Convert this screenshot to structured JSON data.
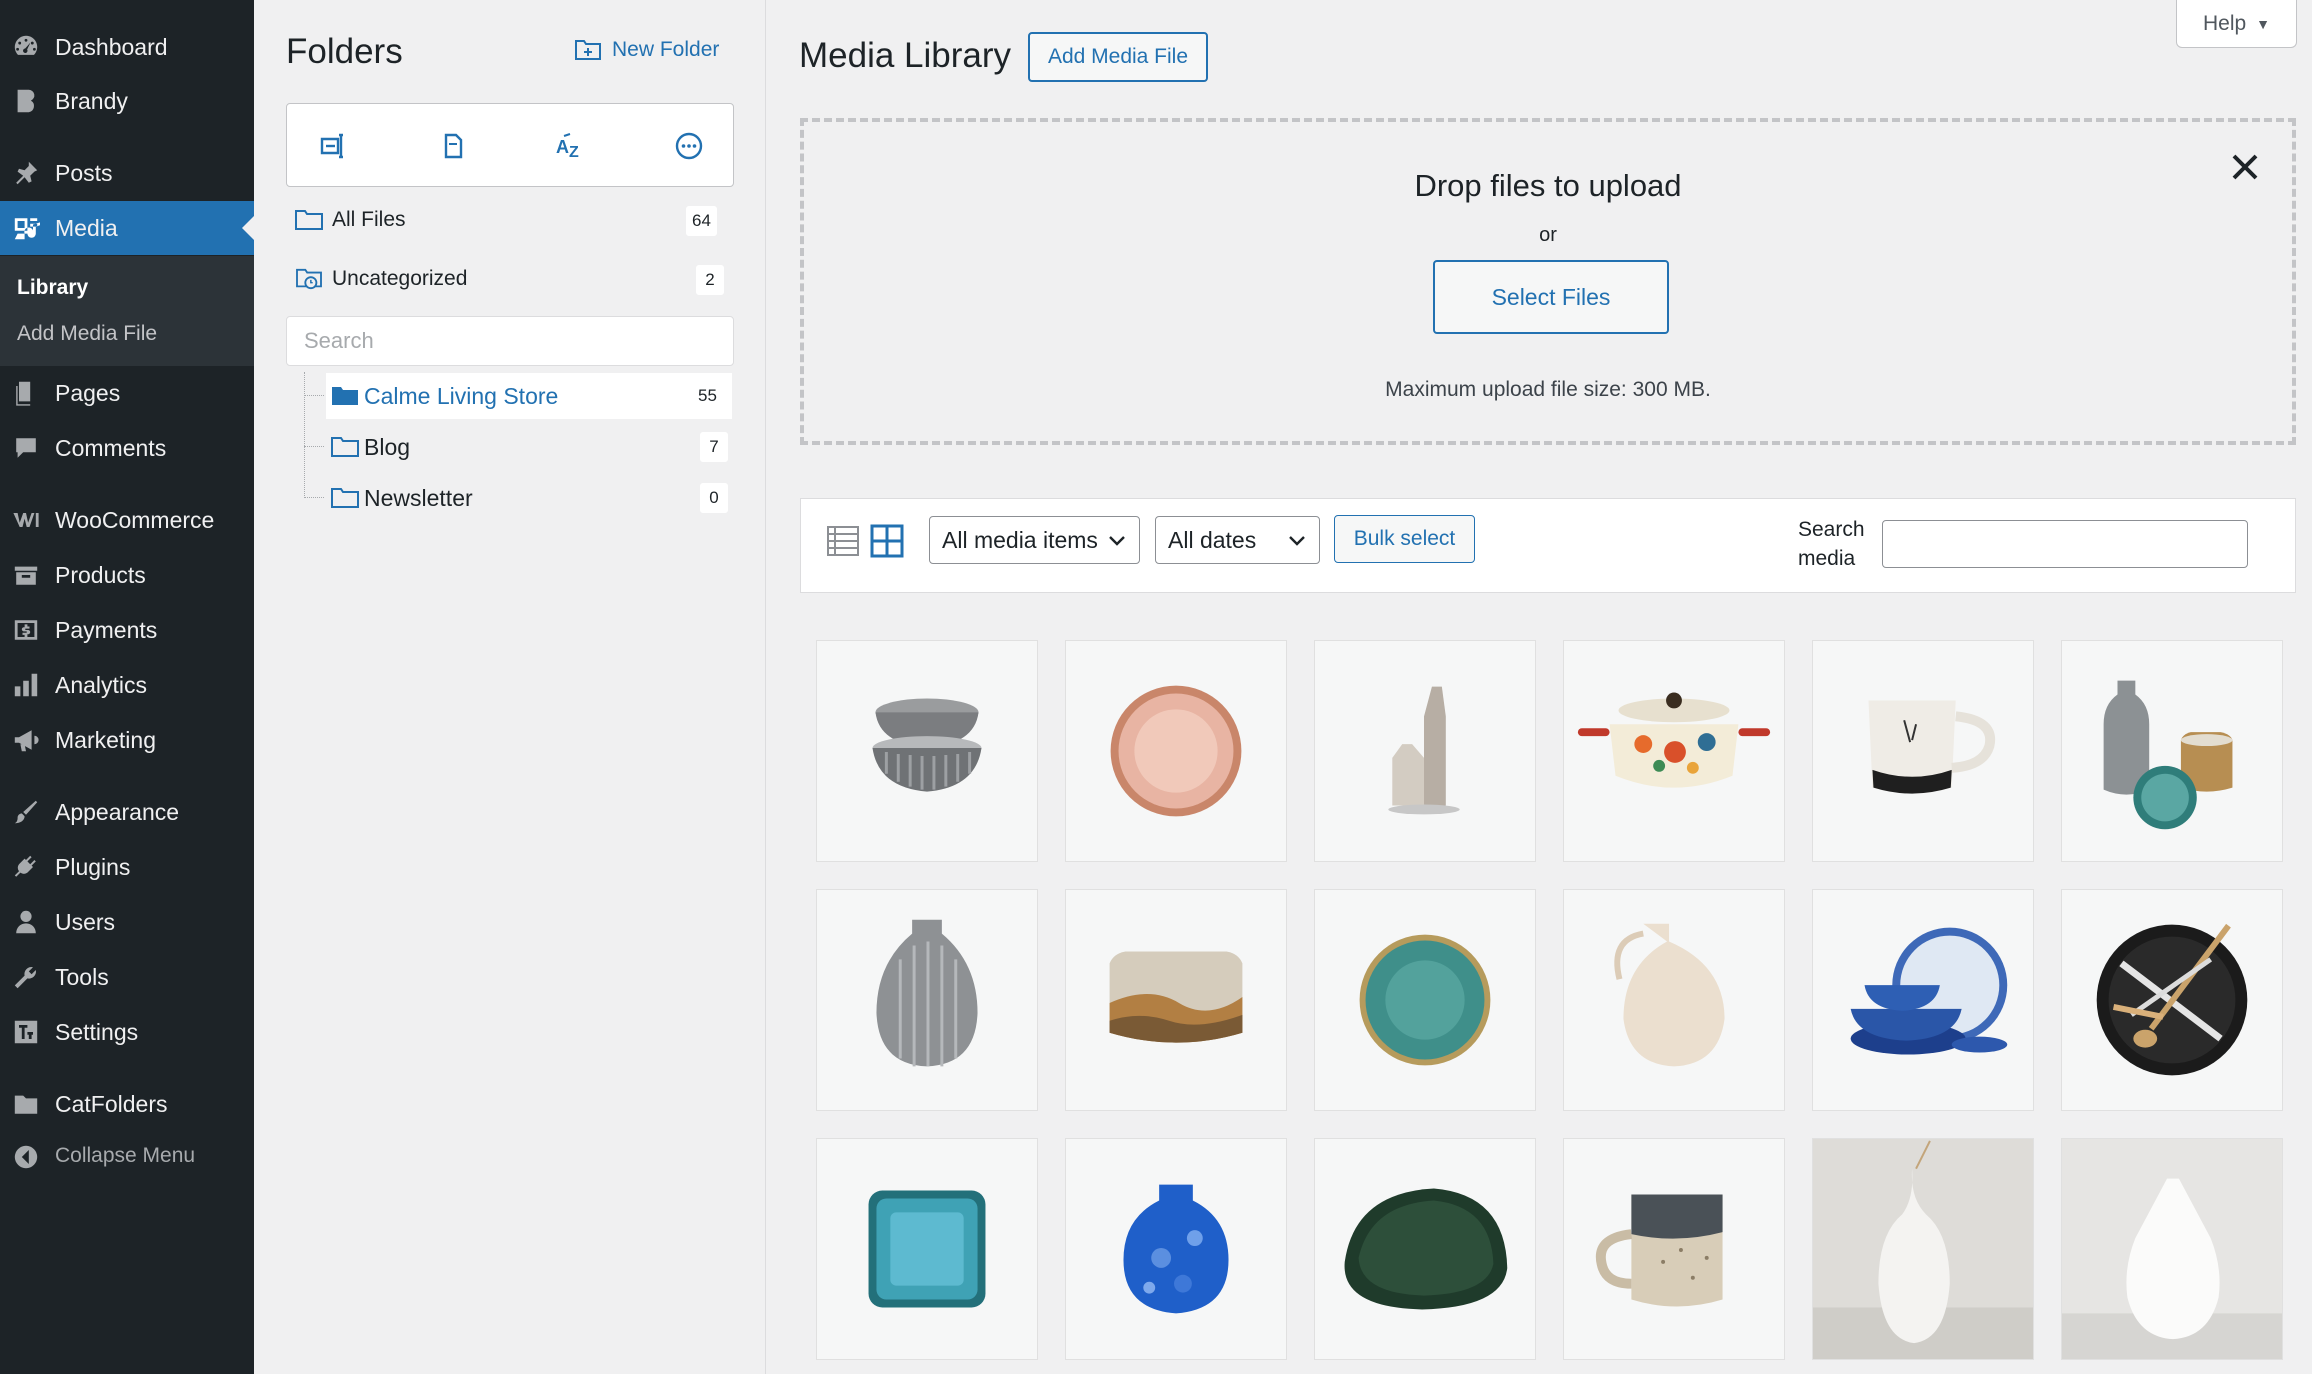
{
  "admin_menu": {
    "items": [
      {
        "label": "Dashboard",
        "icon": "dashboard-icon"
      },
      {
        "label": "Brandy",
        "icon": "brandy-icon"
      },
      {
        "label": "Posts",
        "icon": "pin-icon"
      },
      {
        "label": "Media",
        "icon": "media-icon",
        "current": true
      },
      {
        "label": "Pages",
        "icon": "pages-icon"
      },
      {
        "label": "Comments",
        "icon": "comments-icon"
      },
      {
        "label": "WooCommerce",
        "icon": "woocommerce-icon"
      },
      {
        "label": "Products",
        "icon": "products-icon"
      },
      {
        "label": "Payments",
        "icon": "payments-icon"
      },
      {
        "label": "Analytics",
        "icon": "analytics-icon"
      },
      {
        "label": "Marketing",
        "icon": "megaphone-icon"
      },
      {
        "label": "Appearance",
        "icon": "brush-icon"
      },
      {
        "label": "Plugins",
        "icon": "plug-icon"
      },
      {
        "label": "Users",
        "icon": "users-icon"
      },
      {
        "label": "Tools",
        "icon": "wrench-icon"
      },
      {
        "label": "Settings",
        "icon": "settings-icon"
      },
      {
        "label": "CatFolders",
        "icon": "folder-icon"
      }
    ],
    "submenu": [
      "Library",
      "Add Media File"
    ],
    "collapse_label": "Collapse Menu"
  },
  "folders": {
    "title": "Folders",
    "new_folder_label": "New Folder",
    "all_files": {
      "label": "All Files",
      "count": "64"
    },
    "uncategorized": {
      "label": "Uncategorized",
      "count": "2"
    },
    "search_placeholder": "Search",
    "tree": [
      {
        "label": "Calme Living Store",
        "count": "55",
        "selected": true
      },
      {
        "label": "Blog",
        "count": "7"
      },
      {
        "label": "Newsletter",
        "count": "0"
      }
    ]
  },
  "main": {
    "help_label": "Help",
    "title": "Media Library",
    "add_media_label": "Add Media File",
    "upload": {
      "title": "Drop files to upload",
      "or": "or",
      "select_label": "Select Files",
      "max_size": "Maximum upload file size: 300 MB."
    },
    "filters": {
      "type_value": "All media items",
      "date_value": "All dates",
      "bulk_label": "Bulk select",
      "search_label": "Search media"
    }
  },
  "colors": {
    "accent": "#2271b1",
    "sidebar_bg": "#1d2327",
    "page_bg": "#f0f0f1"
  }
}
